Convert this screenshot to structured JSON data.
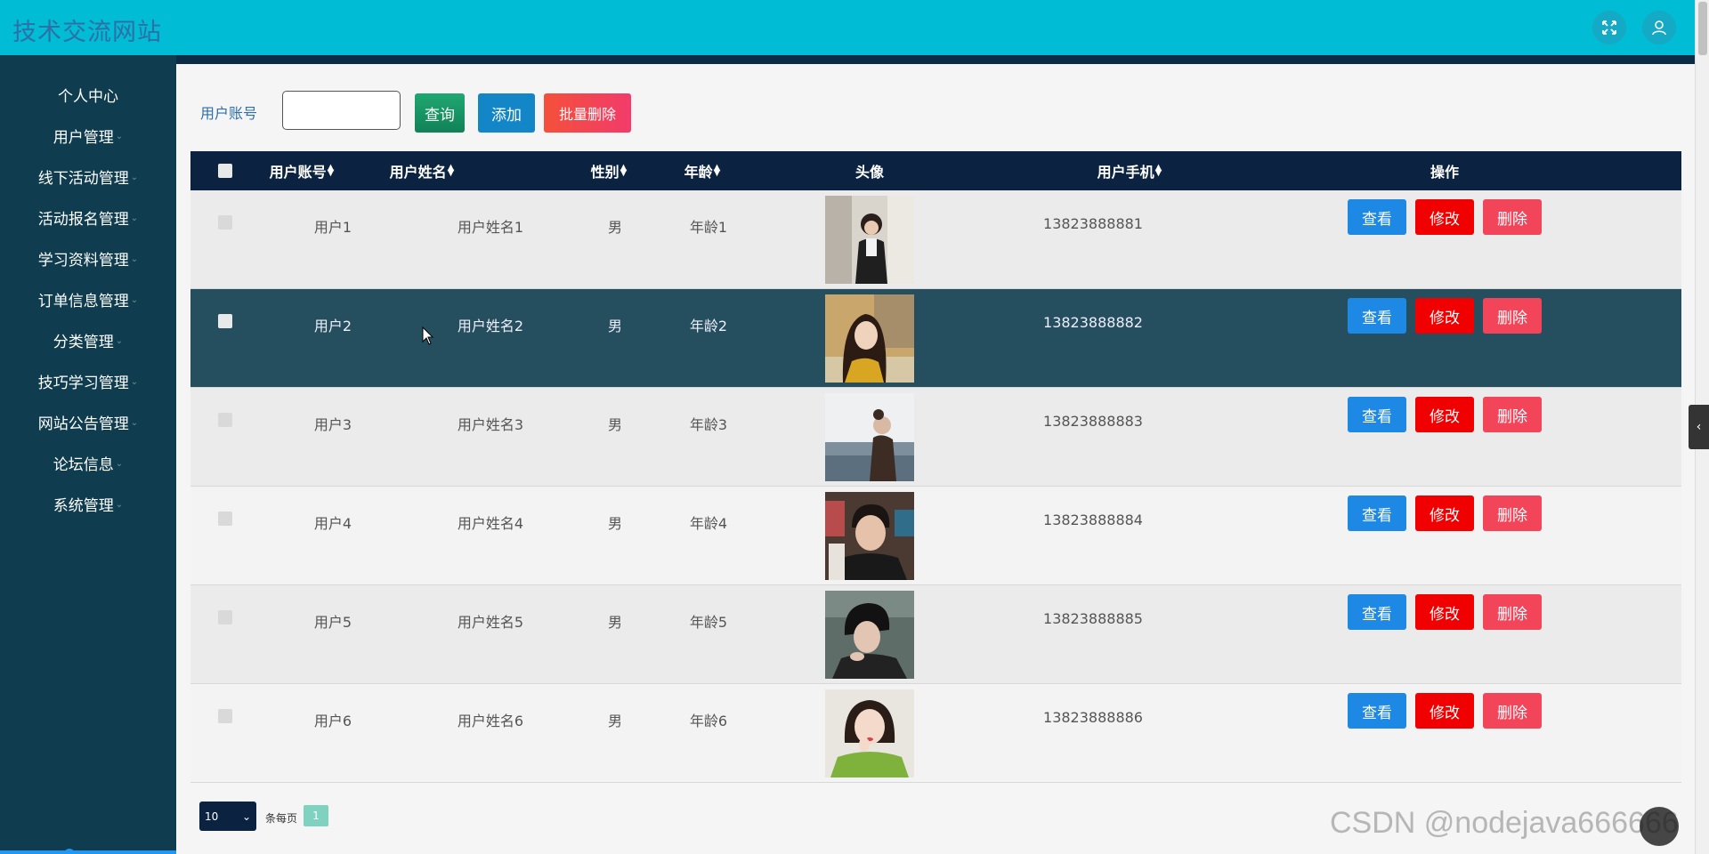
{
  "header": {
    "title": "技术交流网站",
    "icons": [
      "fullscreen-icon",
      "user-icon"
    ]
  },
  "sidebar": {
    "items": [
      {
        "label": "个人中心"
      },
      {
        "label": "用户管理"
      },
      {
        "label": "线下活动管理"
      },
      {
        "label": "活动报名管理"
      },
      {
        "label": "学习资料管理"
      },
      {
        "label": "订单信息管理"
      },
      {
        "label": "分类管理"
      },
      {
        "label": "技巧学习管理"
      },
      {
        "label": "网站公告管理"
      },
      {
        "label": "论坛信息"
      },
      {
        "label": "系统管理"
      }
    ]
  },
  "search": {
    "label": "用户账号",
    "value": "",
    "placeholder": "",
    "query_label": "查询",
    "add_label": "添加",
    "batch_delete_label": "批量删除"
  },
  "table": {
    "headers": {
      "account": "用户账号",
      "name": "用户姓名",
      "gender": "性别",
      "age": "年龄",
      "avatar": "头像",
      "phone": "用户手机",
      "actions": "操作"
    },
    "rows": [
      {
        "account": "用户1",
        "name": "用户姓名1",
        "gender": "男",
        "age": "年龄1",
        "phone": "13823888881"
      },
      {
        "account": "用户2",
        "name": "用户姓名2",
        "gender": "男",
        "age": "年龄2",
        "phone": "13823888882"
      },
      {
        "account": "用户3",
        "name": "用户姓名3",
        "gender": "男",
        "age": "年龄3",
        "phone": "13823888883"
      },
      {
        "account": "用户4",
        "name": "用户姓名4",
        "gender": "男",
        "age": "年龄4",
        "phone": "13823888884"
      },
      {
        "account": "用户5",
        "name": "用户姓名5",
        "gender": "男",
        "age": "年龄5",
        "phone": "13823888885"
      },
      {
        "account": "用户6",
        "name": "用户姓名6",
        "gender": "男",
        "age": "年龄6",
        "phone": "13823888886"
      }
    ],
    "actions": {
      "view": "查看",
      "edit": "修改",
      "delete": "删除"
    }
  },
  "pagination": {
    "page_size": "10",
    "per_page_label": "条每页",
    "current_page": "1"
  },
  "watermark": "CSDN @nodejava666666",
  "colors": {
    "topbar": "#00bcd4",
    "sidebar": "#0f3d4f",
    "table_header": "#0b2340",
    "view_button": "#1e88e5",
    "edit_button": "#f00000",
    "delete_button": "#f2455a"
  }
}
